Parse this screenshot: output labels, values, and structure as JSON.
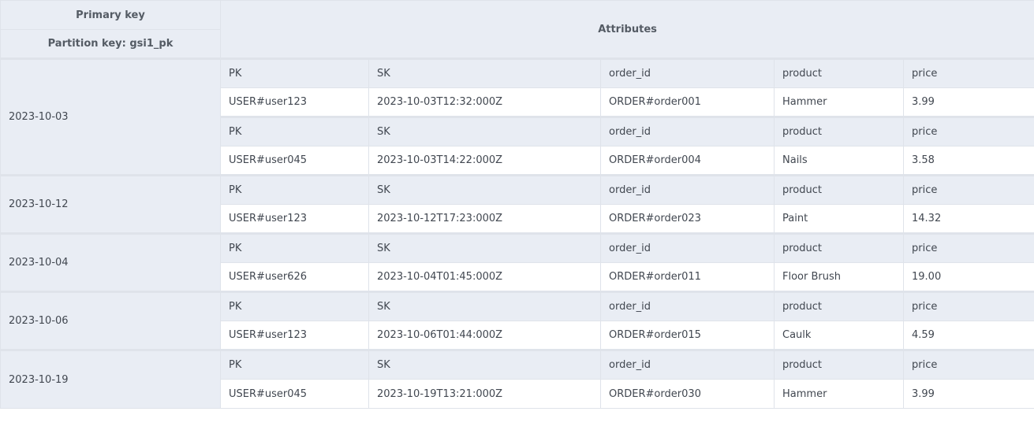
{
  "header": {
    "primary_key": "Primary key",
    "partition_key": "Partition key: gsi1_pk",
    "attributes": "Attributes"
  },
  "attribute_names": [
    "PK",
    "SK",
    "order_id",
    "product",
    "price"
  ],
  "groups": [
    {
      "key": "2023-10-03",
      "items": [
        {
          "values": [
            "USER#user123",
            "2023-10-03T12:32:000Z",
            "ORDER#order001",
            "Hammer",
            "3.99"
          ]
        },
        {
          "values": [
            "USER#user045",
            "2023-10-03T14:22:000Z",
            "ORDER#order004",
            "Nails",
            "3.58"
          ]
        }
      ]
    },
    {
      "key": "2023-10-12",
      "items": [
        {
          "values": [
            "USER#user123",
            "2023-10-12T17:23:000Z",
            "ORDER#order023",
            "Paint",
            "14.32"
          ]
        }
      ]
    },
    {
      "key": "2023-10-04",
      "items": [
        {
          "values": [
            "USER#user626",
            "2023-10-04T01:45:000Z",
            "ORDER#order011",
            "Floor Brush",
            "19.00"
          ]
        }
      ]
    },
    {
      "key": "2023-10-06",
      "items": [
        {
          "values": [
            "USER#user123",
            "2023-10-06T01:44:000Z",
            "ORDER#order015",
            "Caulk",
            "4.59"
          ]
        }
      ]
    },
    {
      "key": "2023-10-19",
      "items": [
        {
          "values": [
            "USER#user045",
            "2023-10-19T13:21:000Z",
            "ORDER#order030",
            "Hammer",
            "3.99"
          ]
        }
      ]
    }
  ]
}
